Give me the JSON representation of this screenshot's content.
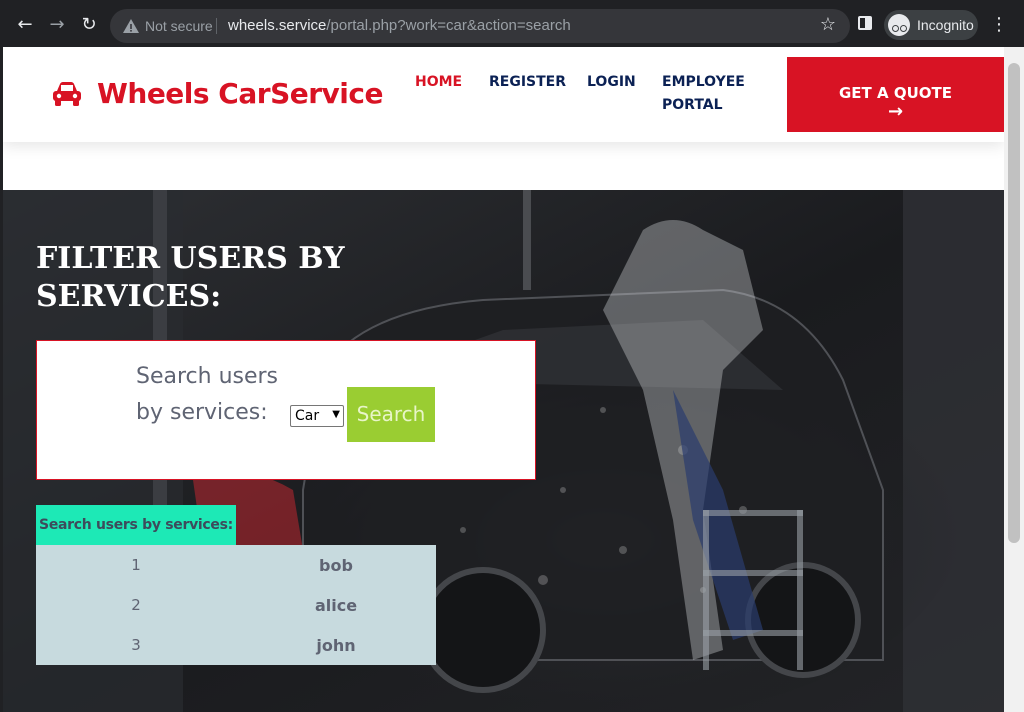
{
  "browser": {
    "security_label": "Not secure",
    "url_host": "wheels.service",
    "url_path": "/portal.php?work=car&action=search",
    "incognito_label": "Incognito"
  },
  "navbar": {
    "brand": "Wheels CarService",
    "links": [
      {
        "label": "HOME",
        "active": true
      },
      {
        "label": "REGISTER",
        "active": false
      },
      {
        "label": "LOGIN",
        "active": false
      },
      {
        "label": "EMPLOYEE",
        "active": false
      },
      {
        "label": "PORTAL",
        "active": false
      }
    ],
    "cta_label": "GET A QUOTE",
    "cta_arrow": "→"
  },
  "hero": {
    "title_line1": "FILTER USERS BY",
    "title_line2": "SERVICES:",
    "search": {
      "label_line1": "Search users",
      "label_line2": "by services:",
      "selected_service": "Car",
      "button_label": "Search"
    },
    "results": {
      "header": "Search users by services:",
      "rows": [
        {
          "index": "1",
          "name": "bob"
        },
        {
          "index": "2",
          "name": "alice"
        },
        {
          "index": "3",
          "name": "john"
        }
      ]
    }
  },
  "colors": {
    "brand_red": "#d81324",
    "navy": "#0b2154",
    "search_green": "#9acd32",
    "teal_header": "#1de9b6",
    "table_bg": "#c7dade"
  }
}
